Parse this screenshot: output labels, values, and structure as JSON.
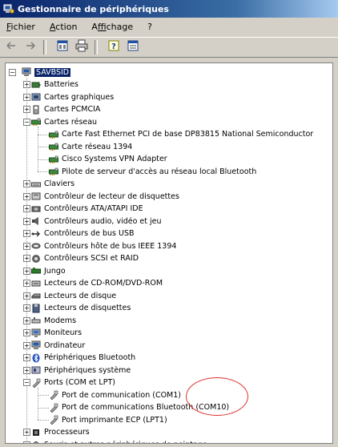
{
  "window": {
    "title": "Gestionnaire de périphériques"
  },
  "menu": [
    {
      "label": "Fichier",
      "accel": "F"
    },
    {
      "label": "Action",
      "accel": "A"
    },
    {
      "label": "Affichage",
      "accel": "f"
    },
    {
      "label": "?",
      "accel": "?"
    }
  ],
  "toolbar": [
    {
      "name": "back-icon",
      "glyph": "←"
    },
    {
      "name": "forward-icon",
      "glyph": "→"
    },
    {
      "name": "view-icon",
      "glyph": "▦"
    },
    {
      "name": "print-icon",
      "glyph": "🖶"
    },
    {
      "name": "help-icon",
      "glyph": "?"
    },
    {
      "name": "properties-icon",
      "glyph": "▤"
    }
  ],
  "tree": {
    "root": "SAVBSID",
    "nodes": [
      {
        "label": "Batteries",
        "level": 1,
        "state": "collapsed",
        "icon": "battery-icon"
      },
      {
        "label": "Cartes graphiques",
        "level": 1,
        "state": "collapsed",
        "icon": "display-adapter-icon"
      },
      {
        "label": "Cartes PCMCIA",
        "level": 1,
        "state": "collapsed",
        "icon": "pcmcia-icon"
      },
      {
        "label": "Cartes réseau",
        "level": 1,
        "state": "expanded",
        "icon": "network-card-icon"
      },
      {
        "label": "Carte Fast Ethernet PCI de base DP83815 National Semiconductor",
        "level": 2,
        "state": "leaf",
        "icon": "network-card-icon"
      },
      {
        "label": "Carte réseau 1394",
        "level": 2,
        "state": "leaf",
        "icon": "network-card-icon"
      },
      {
        "label": "Cisco Systems VPN Adapter",
        "level": 2,
        "state": "leaf",
        "icon": "network-card-icon"
      },
      {
        "label": "Pilote de serveur d'accès au réseau local Bluetooth",
        "level": 2,
        "state": "leaf",
        "icon": "network-card-icon"
      },
      {
        "label": "Claviers",
        "level": 1,
        "state": "collapsed",
        "icon": "keyboard-icon"
      },
      {
        "label": "Contrôleur de lecteur de disquettes",
        "level": 1,
        "state": "collapsed",
        "icon": "floppy-controller-icon"
      },
      {
        "label": "Contrôleurs ATA/ATAPI IDE",
        "level": 1,
        "state": "collapsed",
        "icon": "ide-controller-icon"
      },
      {
        "label": "Contrôleurs audio, vidéo et jeu",
        "level": 1,
        "state": "collapsed",
        "icon": "audio-icon"
      },
      {
        "label": "Contrôleurs de bus USB",
        "level": 1,
        "state": "collapsed",
        "icon": "usb-icon"
      },
      {
        "label": "Contrôleurs hôte de bus IEEE 1394",
        "level": 1,
        "state": "collapsed",
        "icon": "ieee1394-icon"
      },
      {
        "label": "Contrôleurs SCSI et RAID",
        "level": 1,
        "state": "collapsed",
        "icon": "scsi-icon"
      },
      {
        "label": "Jungo",
        "level": 1,
        "state": "collapsed",
        "icon": "jungo-icon"
      },
      {
        "label": "Lecteurs de CD-ROM/DVD-ROM",
        "level": 1,
        "state": "collapsed",
        "icon": "cdrom-icon"
      },
      {
        "label": "Lecteurs de disque",
        "level": 1,
        "state": "collapsed",
        "icon": "disk-drive-icon"
      },
      {
        "label": "Lecteurs de disquettes",
        "level": 1,
        "state": "collapsed",
        "icon": "floppy-drive-icon"
      },
      {
        "label": "Modems",
        "level": 1,
        "state": "collapsed",
        "icon": "modem-icon"
      },
      {
        "label": "Moniteurs",
        "level": 1,
        "state": "collapsed",
        "icon": "monitor-icon"
      },
      {
        "label": "Ordinateur",
        "level": 1,
        "state": "collapsed",
        "icon": "computer-icon"
      },
      {
        "label": "Périphériques Bluetooth",
        "level": 1,
        "state": "collapsed",
        "icon": "bluetooth-icon"
      },
      {
        "label": "Périphériques système",
        "level": 1,
        "state": "collapsed",
        "icon": "system-device-icon"
      },
      {
        "label": "Ports (COM et LPT)",
        "level": 1,
        "state": "expanded",
        "icon": "port-icon"
      },
      {
        "label": "Port de communication (COM1)",
        "level": 2,
        "state": "leaf",
        "icon": "port-icon"
      },
      {
        "label": "Port de communications Bluetooth (COM10)",
        "level": 2,
        "state": "leaf",
        "icon": "port-icon"
      },
      {
        "label": "Port imprimante ECP (LPT1)",
        "level": 2,
        "state": "leaf",
        "icon": "port-icon"
      },
      {
        "label": "Processeurs",
        "level": 1,
        "state": "collapsed",
        "icon": "processor-icon"
      },
      {
        "label": "Souris et autres périphériques de pointage",
        "level": 1,
        "state": "collapsed",
        "icon": "mouse-icon"
      }
    ]
  }
}
